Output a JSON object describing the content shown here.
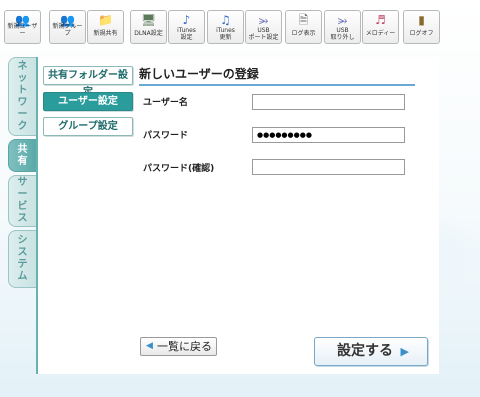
{
  "toolbar": [
    {
      "label": "新規ユーザー",
      "icon": "users-icon",
      "glyph": "👥"
    },
    {
      "label": "新規グループ",
      "icon": "group-icon",
      "glyph": "👥"
    },
    {
      "label": "新規共有",
      "icon": "folder-icon",
      "glyph": "📁"
    },
    {
      "label": "DLNA設定",
      "icon": "dlna-icon",
      "glyph": "🖥"
    },
    {
      "label": "iTunes\n設定",
      "icon": "music-note-icon",
      "glyph": "♪"
    },
    {
      "label": "iTunes\n更新",
      "icon": "music-notes-icon",
      "glyph": "♫"
    },
    {
      "label": "USB\nポート設定",
      "icon": "usb-icon",
      "glyph": "⭃"
    },
    {
      "label": "ログ表示",
      "icon": "log-icon",
      "glyph": "🗎"
    },
    {
      "label": "USB\n取り外し",
      "icon": "usb-remove-icon",
      "glyph": "⭃"
    },
    {
      "label": "メロディー",
      "icon": "melody-icon",
      "glyph": "♬"
    },
    {
      "label": "ログオフ",
      "icon": "logoff-icon",
      "glyph": "▮"
    }
  ],
  "sidebar": {
    "tabs": [
      {
        "label": "ネットワーク",
        "chars": [
          "ネ",
          "ッ",
          "ト",
          "ワ",
          "ー",
          "ク"
        ],
        "active": false
      },
      {
        "label": "共有",
        "chars": [
          "共",
          "有"
        ],
        "active": true
      },
      {
        "label": "サービス",
        "chars": [
          "サ",
          "ー",
          "ビ",
          "ス"
        ],
        "active": false
      },
      {
        "label": "システム",
        "chars": [
          "シ",
          "ス",
          "テ",
          "ム"
        ],
        "active": false
      }
    ]
  },
  "subnav": {
    "shared_folder": "共有フォルダー設定",
    "user": "ユーザー設定",
    "group": "グループ設定"
  },
  "form": {
    "title": "新しいユーザーの登録",
    "username_label": "ユーザー名",
    "username_value": "",
    "password_label": "パスワード",
    "password_value": "●●●●●●●●●",
    "password_confirm_label": "パスワード(確認)",
    "password_confirm_value": ""
  },
  "buttons": {
    "back": "一覧に戻る",
    "submit": "設定する"
  },
  "colors": {
    "accent_teal": "#2a9c9c",
    "title_underline": "#6aa9d6"
  }
}
